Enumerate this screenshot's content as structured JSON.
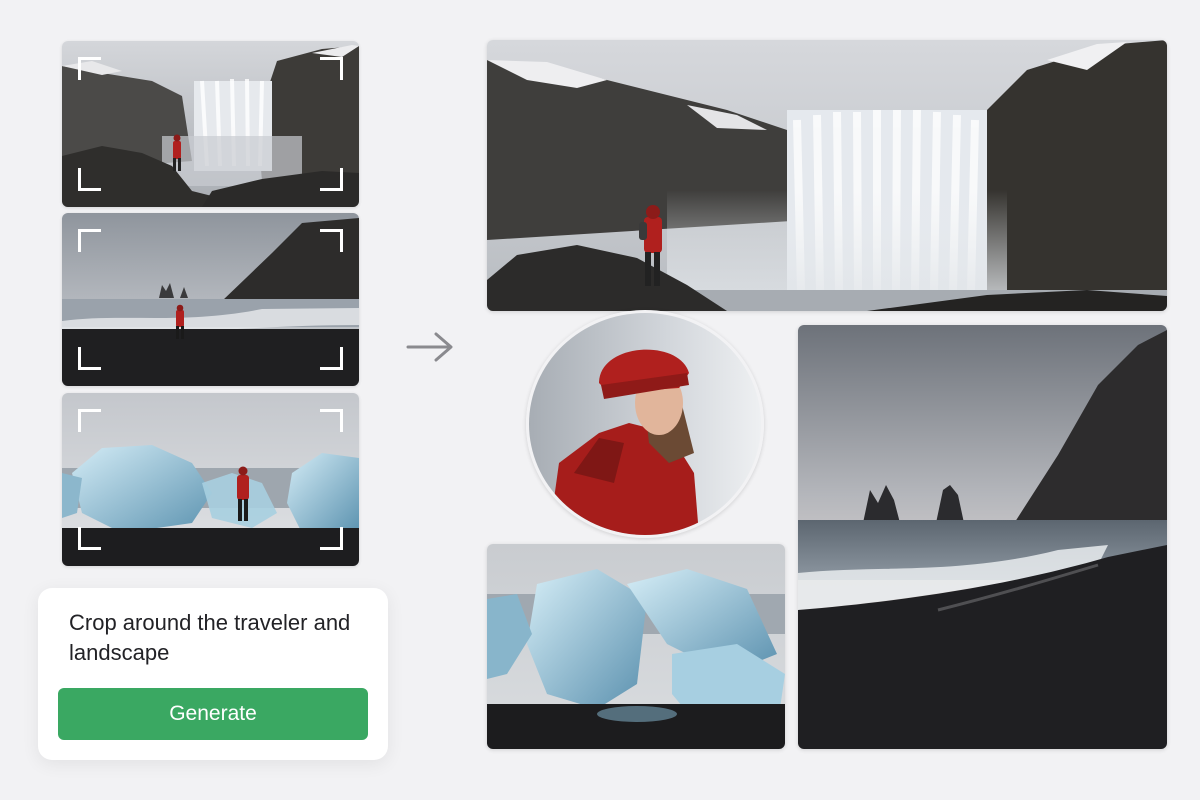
{
  "inputs": {
    "images": [
      {
        "name": "waterfall-thumbnail",
        "subject": "traveler at waterfall"
      },
      {
        "name": "black-beach-thumbnail",
        "subject": "traveler on black sand beach"
      },
      {
        "name": "glacier-ice-thumbnail",
        "subject": "traveler among glacier ice"
      }
    ]
  },
  "prompt": {
    "text": "Crop around the traveler and landscape",
    "button_label": "Generate"
  },
  "flow_icon": "arrow-right-icon",
  "outputs": {
    "crops": [
      {
        "name": "waterfall-wide-crop",
        "shape": "rectangle"
      },
      {
        "name": "portrait-circle-crop",
        "shape": "circle"
      },
      {
        "name": "glacier-ice-crop",
        "shape": "rectangle"
      },
      {
        "name": "sea-stacks-beach-crop",
        "shape": "rectangle"
      }
    ]
  },
  "colors": {
    "background": "#f2f2f4",
    "button": "#3aa862",
    "jacket": "#b0201e"
  }
}
